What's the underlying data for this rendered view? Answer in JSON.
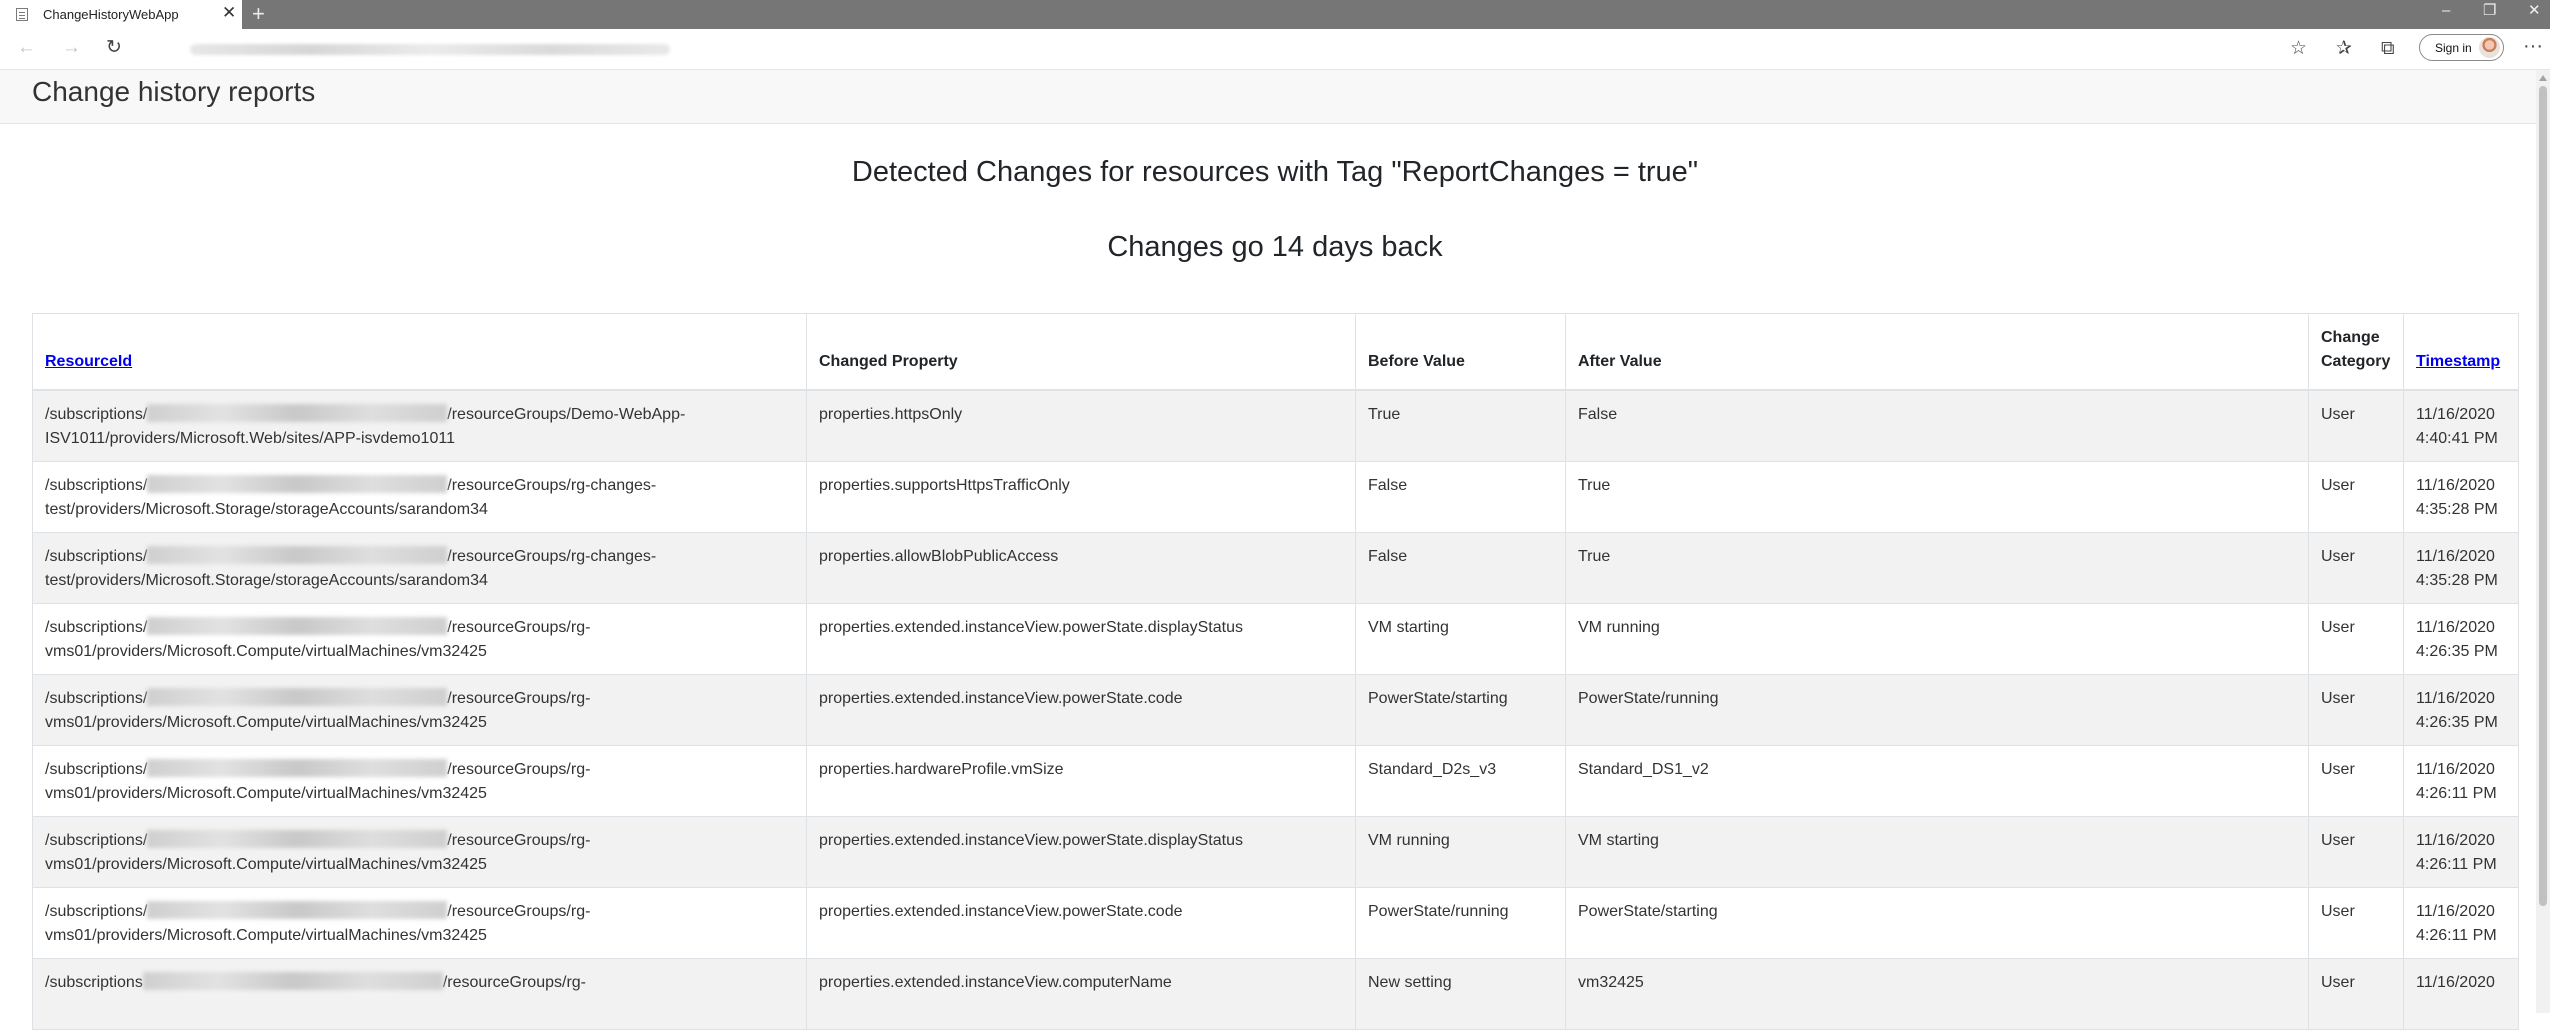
{
  "browser": {
    "tab_title": "ChangeHistoryWebApp",
    "sign_in_label": "Sign in"
  },
  "app": {
    "brand": "Change history reports"
  },
  "main": {
    "heading": "Detected Changes for resources with Tag \"ReportChanges = true\"",
    "subheading": "Changes go 14 days back"
  },
  "table": {
    "headers": {
      "resource_id": "ResourceId",
      "changed_property": "Changed Property",
      "before_value": "Before Value",
      "after_value": "After Value",
      "change_category_1": "Change",
      "change_category_2": "Category",
      "timestamp": "Timestamp"
    },
    "rows": [
      {
        "rid_prefix": "/subscriptions/",
        "rid_mid": "/resourceGroups/Demo-WebApp-",
        "rid_line2": "ISV1011/providers/Microsoft.Web/sites/APP-isvdemo1011",
        "property": "properties.httpsOnly",
        "before": "True",
        "after": "False",
        "category": "User",
        "date": "11/16/2020",
        "time": "4:40:41 PM"
      },
      {
        "rid_prefix": "/subscriptions/",
        "rid_mid": "/resourceGroups/rg-changes-",
        "rid_line2": "test/providers/Microsoft.Storage/storageAccounts/sarandom34",
        "property": "properties.supportsHttpsTrafficOnly",
        "before": "False",
        "after": "True",
        "category": "User",
        "date": "11/16/2020",
        "time": "4:35:28 PM"
      },
      {
        "rid_prefix": "/subscriptions/",
        "rid_mid": "/resourceGroups/rg-changes-",
        "rid_line2": "test/providers/Microsoft.Storage/storageAccounts/sarandom34",
        "property": "properties.allowBlobPublicAccess",
        "before": "False",
        "after": "True",
        "category": "User",
        "date": "11/16/2020",
        "time": "4:35:28 PM"
      },
      {
        "rid_prefix": "/subscriptions/",
        "rid_mid": "/resourceGroups/rg-",
        "rid_line2": "vms01/providers/Microsoft.Compute/virtualMachines/vm32425",
        "property": "properties.extended.instanceView.powerState.displayStatus",
        "before": "VM starting",
        "after": "VM running",
        "category": "User",
        "date": "11/16/2020",
        "time": "4:26:35 PM"
      },
      {
        "rid_prefix": "/subscriptions/",
        "rid_mid": "/resourceGroups/rg-",
        "rid_line2": "vms01/providers/Microsoft.Compute/virtualMachines/vm32425",
        "property": "properties.extended.instanceView.powerState.code",
        "before": "PowerState/starting",
        "after": "PowerState/running",
        "category": "User",
        "date": "11/16/2020",
        "time": "4:26:35 PM"
      },
      {
        "rid_prefix": "/subscriptions/",
        "rid_mid": "/resourceGroups/rg-",
        "rid_line2": "vms01/providers/Microsoft.Compute/virtualMachines/vm32425",
        "property": "properties.hardwareProfile.vmSize",
        "before": "Standard_D2s_v3",
        "after": "Standard_DS1_v2",
        "category": "User",
        "date": "11/16/2020",
        "time": "4:26:11 PM"
      },
      {
        "rid_prefix": "/subscriptions/",
        "rid_mid": "/resourceGroups/rg-",
        "rid_line2": "vms01/providers/Microsoft.Compute/virtualMachines/vm32425",
        "property": "properties.extended.instanceView.powerState.displayStatus",
        "before": "VM running",
        "after": "VM starting",
        "category": "User",
        "date": "11/16/2020",
        "time": "4:26:11 PM"
      },
      {
        "rid_prefix": "/subscriptions/",
        "rid_mid": "/resourceGroups/rg-",
        "rid_line2": "vms01/providers/Microsoft.Compute/virtualMachines/vm32425",
        "property": "properties.extended.instanceView.powerState.code",
        "before": "PowerState/running",
        "after": "PowerState/starting",
        "category": "User",
        "date": "11/16/2020",
        "time": "4:26:11 PM"
      },
      {
        "rid_prefix": "/subscriptions",
        "rid_mid": "/resourceGroups/rg-",
        "rid_line2": "",
        "property": "properties.extended.instanceView.computerName",
        "before": "New setting",
        "after": "vm32425",
        "category": "User",
        "date": "11/16/2020",
        "time": ""
      }
    ]
  }
}
